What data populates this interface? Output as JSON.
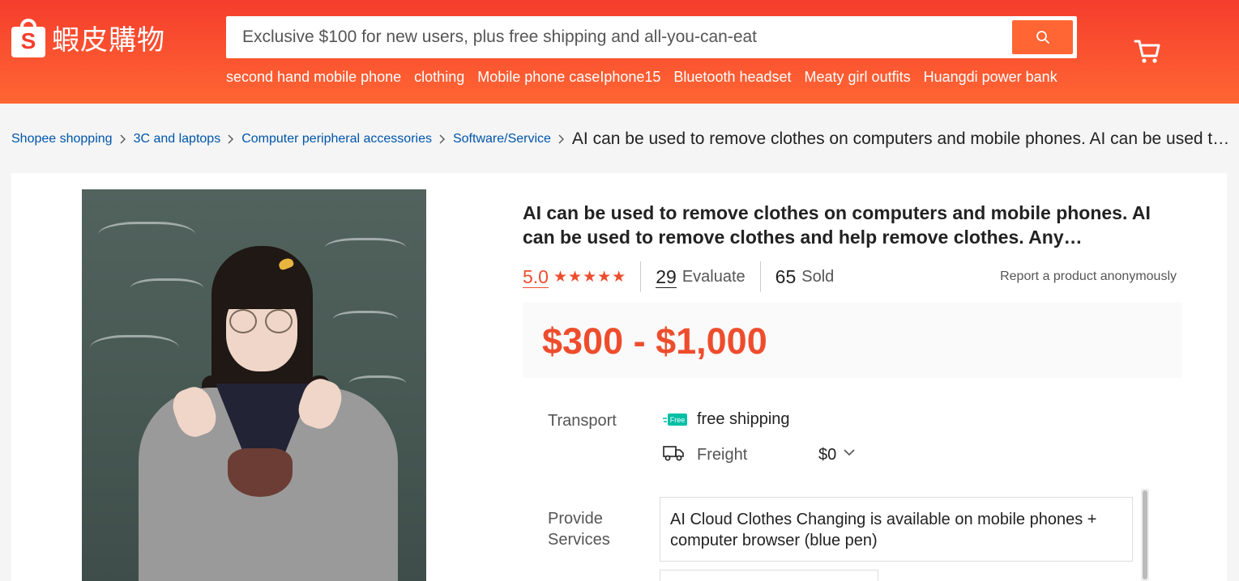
{
  "header": {
    "logo_text": "蝦皮購物",
    "logo_letter": "S",
    "search_placeholder": "Exclusive $100 for new users, plus free shipping and all-you-can-eat",
    "hot_words": [
      "second hand mobile phone",
      "clothing",
      "Mobile phone caseIphone15",
      "Bluetooth headset",
      "Meaty girl outfits",
      "Huangdi power bank"
    ]
  },
  "breadcrumb": {
    "items": [
      "Shopee shopping",
      "3C and laptops",
      "Computer peripheral accessories",
      "Software/Service"
    ],
    "current": "AI can be used to remove clothes on computers and mobile phones. AI can be used to remove clothes and help remove clothes. Any..."
  },
  "product": {
    "title": "AI can be used to remove clothes on computers and mobile phones. AI can be used to remove clothes and help remove clothes. Any…",
    "rating": "5.0",
    "stars": 5,
    "evaluate_count": "29",
    "evaluate_label": "Evaluate",
    "sold_count": "65",
    "sold_label": "Sold",
    "report_label": "Report a product anonymously",
    "price": "$300 - $1,000",
    "transport_label": "Transport",
    "free_badge": "Free",
    "free_shipping": "free shipping",
    "freight_label": "Freight",
    "freight_value": "$0",
    "services_label_1": "Provide",
    "services_label_2": "Services",
    "service_option": "AI Cloud Clothes Changing is available on mobile phones + computer browser (blue pen)"
  },
  "colors": {
    "brand": "#f53d2d",
    "accent": "#ee4d2d",
    "link": "#0055aa"
  }
}
